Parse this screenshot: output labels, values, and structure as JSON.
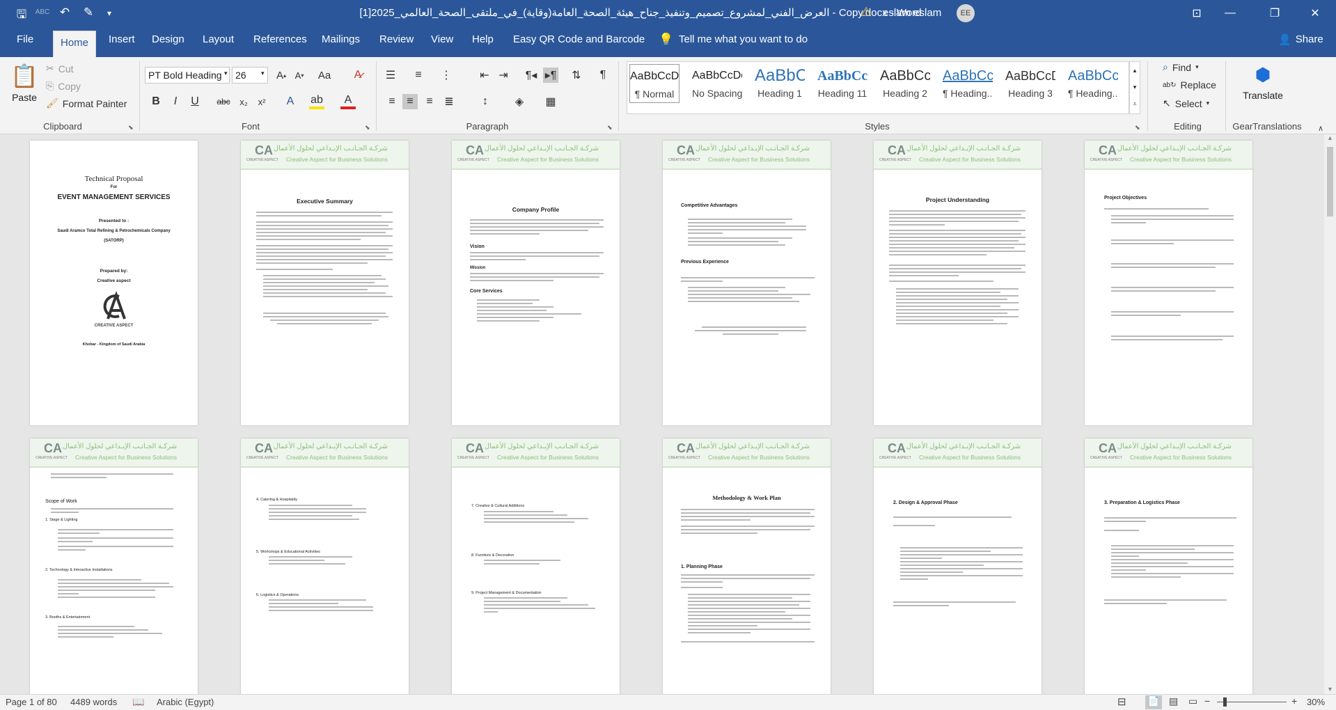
{
  "window": {
    "title": "العرض_الفني_لمشروع_تصميم_وتنفيذ_جناح_هيئة_الصحة_العامة(وقاية)_في_ملتقى_الصحة_العالمي_2025[1] - Copy.docx  -  Word",
    "user_name": "eslam eslam",
    "user_initials": "EE",
    "warning_icon": "warning-icon",
    "accent_color": "#2b579a"
  },
  "tabs": [
    "File",
    "Home",
    "Insert",
    "Design",
    "Layout",
    "References",
    "Mailings",
    "Review",
    "View",
    "Help",
    "Easy QR Code and Barcode"
  ],
  "active_tab": "Home",
  "tell_me": "Tell me what you want to do",
  "share": "Share",
  "clipboard": {
    "paste": "Paste",
    "cut": "Cut",
    "copy": "Copy",
    "format_painter": "Format Painter",
    "group": "Clipboard"
  },
  "font": {
    "name": "PT Bold Heading",
    "size": "26",
    "group": "Font"
  },
  "paragraph": {
    "group": "Paragraph"
  },
  "styles": {
    "group": "Styles",
    "items": [
      {
        "preview": "AaBbCcDd",
        "name": "¶ Normal"
      },
      {
        "preview": "AaBbCcDd",
        "name": "No Spacing"
      },
      {
        "preview": "AaBbC",
        "name": "Heading 1"
      },
      {
        "preview": "AaBbCc",
        "name": "Heading 11"
      },
      {
        "preview": "AaBbCc",
        "name": "Heading 2"
      },
      {
        "preview": "AaBbCc",
        "name": "¶ Heading..."
      },
      {
        "preview": "AaBbCcD",
        "name": "Heading 3"
      },
      {
        "preview": "AaBbCc",
        "name": "¶ Heading..."
      }
    ]
  },
  "editing": {
    "find": "Find",
    "replace": "Replace",
    "select": "Select",
    "group": "Editing"
  },
  "gear": {
    "translate": "Translate",
    "group": "GearTranslations"
  },
  "header_logo": {
    "arabic": "شركـة الجـانـب الإبـداعي لحلول الأعمال",
    "english": "Creative Aspect for Business Solutions",
    "mark": "CA",
    "mark_caption": "CREATIVE ASPECT"
  },
  "cover": {
    "title": "Technical Proposal",
    "for": "For",
    "subtitle": "EVENT MANAGEMENT SERVICES",
    "presented_to": "Presented to :",
    "client": "Saudi Aramco Total Refining & Petrochemicals Company",
    "client_short": "(SATORP)",
    "prepared_by": "Prepared by:",
    "preparer": "Creative aspect",
    "logo_caption": "CREATIVE ASPECT",
    "location": "Khobar - Kingdom of Saudi Arabia"
  },
  "pages_row1": [
    {
      "title": "Executive Summary"
    },
    {
      "title": "Company Profile",
      "sections": [
        "Vision",
        "Mission",
        "Core Services"
      ]
    },
    {
      "title": "Competitive Advantages",
      "sections": [
        "Previous Experience"
      ]
    },
    {
      "title": "Project Understanding"
    },
    {
      "title": "Project Objectives"
    }
  ],
  "pages_row2": [
    {
      "sections": [
        "Scope of Work",
        "1. Stage & Lighting",
        "2. Technology & Interactive Installations",
        "3. Booths & Entertainment"
      ]
    },
    {
      "sections": [
        "4. Catering & Hospitality",
        "5. Workshops & Educational Activities",
        "6. Logistics & Operations"
      ]
    },
    {
      "sections": [
        "7. Creative & Cultural Additions",
        "8. Furniture & Decoration",
        "9. Project Management & Documentation"
      ]
    },
    {
      "title": "Methodology & Work Plan",
      "sections": [
        "1. Planning Phase"
      ]
    },
    {
      "sections": [
        "2. Design & Approval Phase"
      ]
    },
    {
      "sections": [
        "3. Preparation & Logistics Phase"
      ]
    }
  ],
  "status": {
    "page": "Page 1 of 80",
    "words": "4489 words",
    "language": "Arabic (Egypt)",
    "zoom": "30%"
  }
}
